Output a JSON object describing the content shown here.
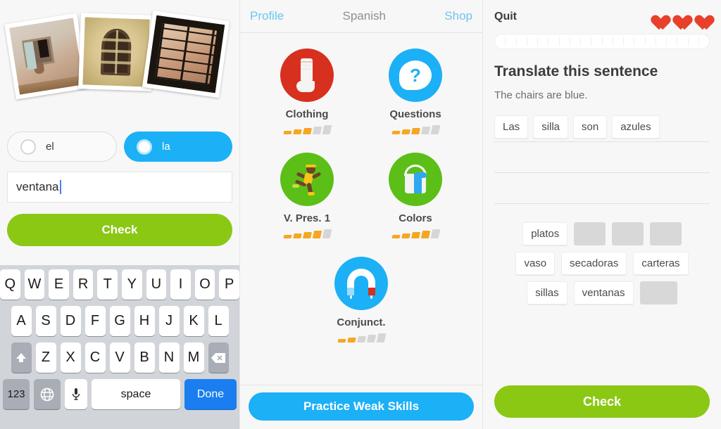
{
  "word_exercise": {
    "photos": [
      {
        "alt": "weathered-wall-window"
      },
      {
        "alt": "ornate-baroque-window"
      },
      {
        "alt": "dark-framed-window"
      }
    ],
    "options": [
      {
        "label": "el",
        "selected": false
      },
      {
        "label": "la",
        "selected": true
      }
    ],
    "answer_value": "ventana",
    "answer_placeholder": "",
    "check_label": "Check"
  },
  "keyboard": {
    "row1": [
      "Q",
      "W",
      "E",
      "R",
      "T",
      "Y",
      "U",
      "I",
      "O",
      "P"
    ],
    "row2": [
      "A",
      "S",
      "D",
      "F",
      "G",
      "H",
      "J",
      "K",
      "L"
    ],
    "row3": [
      "Z",
      "X",
      "C",
      "V",
      "B",
      "N",
      "M"
    ],
    "shift_icon": "shift-icon",
    "backspace_icon": "backspace-icon",
    "numbers_label": "123",
    "globe_icon": "globe-icon",
    "mic_icon": "microphone-icon",
    "space_label": "space",
    "done_label": "Done"
  },
  "skill_tree": {
    "header": {
      "profile_label": "Profile",
      "title": "Spanish",
      "shop_label": "Shop"
    },
    "skills": [
      {
        "label": "Clothing",
        "icon": "sock-icon",
        "color": "#d8301f",
        "strength": 3,
        "max": 5
      },
      {
        "label": "Questions",
        "icon": "question-bubble-icon",
        "color": "#1cb0f6",
        "strength": 3,
        "max": 5
      },
      {
        "label": "V. Pres. 1",
        "icon": "runner-icon",
        "color": "#5bbf17",
        "strength": 4,
        "max": 5
      },
      {
        "label": "Colors",
        "icon": "paint-bucket-icon",
        "color": "#5bbf17",
        "strength": 4,
        "max": 5
      },
      {
        "label": "Conjunct.",
        "icon": "magnet-icon",
        "color": "#1cb0f6",
        "strength": 2,
        "max": 5
      }
    ],
    "practice_label": "Practice Weak Skills"
  },
  "translate_exercise": {
    "quit_label": "Quit",
    "hearts": 3,
    "progress_ticks": 20,
    "progress_filled": 0,
    "title": "Translate this sentence",
    "sentence": "The chairs are blue.",
    "answer_tiles": [
      "Las",
      "silla",
      "son",
      "azules"
    ],
    "word_bank": [
      [
        {
          "label": "platos",
          "used": false
        },
        {
          "label": "",
          "used": true
        },
        {
          "label": "",
          "used": true
        },
        {
          "label": "",
          "used": true
        }
      ],
      [
        {
          "label": "vaso",
          "used": false
        },
        {
          "label": "secadoras",
          "used": false
        },
        {
          "label": "carteras",
          "used": false
        }
      ],
      [
        {
          "label": "sillas",
          "used": false
        },
        {
          "label": "ventanas",
          "used": false
        },
        {
          "label": "",
          "used": true
        }
      ]
    ],
    "check_label": "Check"
  },
  "colors": {
    "green": "#8ac814",
    "blue": "#1cb0f6",
    "red": "#d8301f",
    "heart_red": "#e8402a",
    "orange": "#f5a623",
    "panel_bg": "#f7f7f7"
  }
}
